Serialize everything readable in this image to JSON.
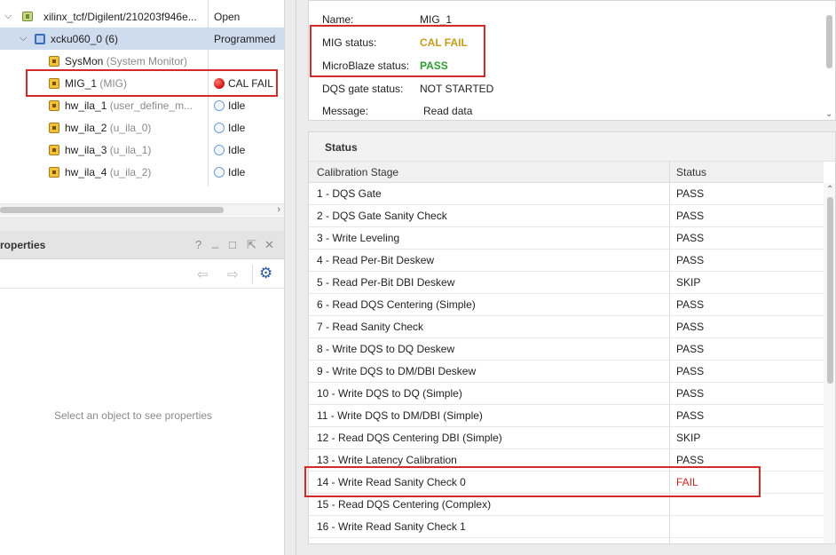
{
  "hardware_tree": {
    "rows": [
      {
        "name": "xilinx_tcf/Digilent/210203f946e...",
        "sub": "",
        "status": "Open"
      },
      {
        "name": "xcku060_0 (6)",
        "sub": "",
        "status": "Programmed"
      },
      {
        "name": "SysMon",
        "sub": "(System Monitor)",
        "status": ""
      },
      {
        "name": "MIG_1",
        "sub": "(MIG)",
        "status": "CAL FAIL"
      },
      {
        "name": "hw_ila_1",
        "sub": "(user_define_m...",
        "status": "Idle"
      },
      {
        "name": "hw_ila_2",
        "sub": "(u_ila_0)",
        "status": "Idle"
      },
      {
        "name": "hw_ila_3",
        "sub": "(u_ila_1)",
        "status": "Idle"
      },
      {
        "name": "hw_ila_4",
        "sub": "(u_ila_2)",
        "status": "Idle"
      }
    ],
    "scroll_right_glyph": "›"
  },
  "properties": {
    "title": "roperties",
    "header_buttons": {
      "help": "?",
      "minimize": "_",
      "restore": "□",
      "float": "⇱",
      "close": "✕"
    },
    "toolbar": {
      "back": "⇦",
      "forward": "⇨",
      "settings": "⚙"
    },
    "empty_message": "Select an object to see properties"
  },
  "mig_info": {
    "name_label": "Name:",
    "name_value": "MIG_1",
    "mig_status_label": "MIG status:",
    "mig_status_value": "CAL FAIL",
    "microblaze_label": "MicroBlaze status:",
    "microblaze_value": "PASS",
    "dqs_gate_label": "DQS gate status:",
    "dqs_gate_value": "NOT STARTED",
    "message_label": "Message:",
    "message_value": "Read data"
  },
  "status_table": {
    "title": "Status",
    "columns": [
      "Calibration Stage",
      "Status"
    ],
    "rows": [
      {
        "stage": "1 - DQS Gate",
        "status": "PASS"
      },
      {
        "stage": "2 - DQS Gate Sanity Check",
        "status": "PASS"
      },
      {
        "stage": "3 - Write Leveling",
        "status": "PASS"
      },
      {
        "stage": "4 - Read Per-Bit Deskew",
        "status": "PASS"
      },
      {
        "stage": "5 - Read Per-Bit DBI Deskew",
        "status": "SKIP"
      },
      {
        "stage": "6 - Read DQS Centering (Simple)",
        "status": "PASS"
      },
      {
        "stage": "7 - Read Sanity Check",
        "status": "PASS"
      },
      {
        "stage": "8 - Write DQS to DQ Deskew",
        "status": "PASS"
      },
      {
        "stage": "9 - Write DQS to DM/DBI Deskew",
        "status": "PASS"
      },
      {
        "stage": "10 - Write DQS to DQ (Simple)",
        "status": "PASS"
      },
      {
        "stage": "11 - Write DQS to DM/DBI (Simple)",
        "status": "PASS"
      },
      {
        "stage": "12 - Read DQS Centering DBI (Simple)",
        "status": "SKIP"
      },
      {
        "stage": "13 - Write Latency Calibration",
        "status": "PASS"
      },
      {
        "stage": "14 - Write Read Sanity Check 0",
        "status": "FAIL"
      },
      {
        "stage": "15 - Read DQS Centering (Complex)",
        "status": ""
      },
      {
        "stage": "16 - Write Read Sanity Check 1",
        "status": ""
      }
    ]
  },
  "colors": {
    "cal_fail": "#c89b1a",
    "pass": "#2e9c2e",
    "fail": "#d12020",
    "highlight": "#d42a2a",
    "selection": "#cfdcef"
  }
}
